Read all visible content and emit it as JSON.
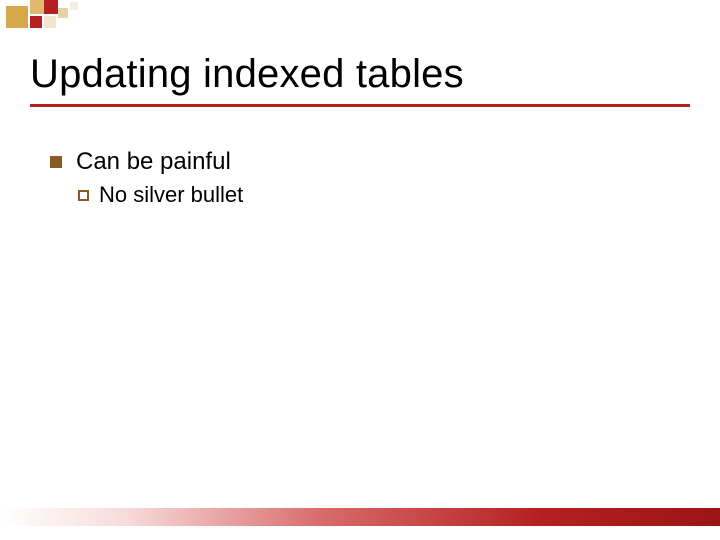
{
  "title": "Updating indexed tables",
  "bullets": [
    {
      "text": "Can be painful",
      "children": [
        {
          "text": "No silver bullet"
        }
      ]
    }
  ],
  "theme": {
    "accent": "#b52020",
    "bullet_color": "#8a5a24"
  }
}
